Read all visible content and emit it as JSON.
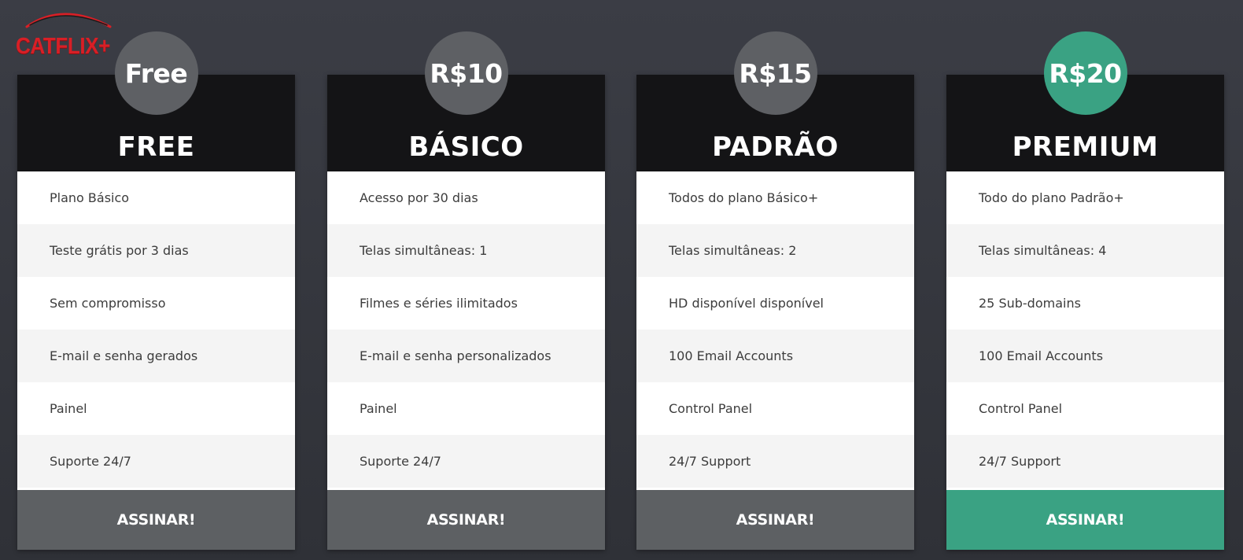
{
  "brand": {
    "logo_text": "CATFLIX+",
    "logo_color": "#d81f26"
  },
  "colors": {
    "background": "#35373d",
    "card_header": "#141416",
    "badge_default": "#5e6064",
    "accent": "#3aa283",
    "button_default": "#5d6063"
  },
  "plans": [
    {
      "price": "Free",
      "name": "FREE",
      "featured": false,
      "features": [
        "Plano Básico",
        "Teste grátis por 3 dias",
        "Sem compromisso",
        "E-mail e senha gerados",
        "Painel",
        "Suporte 24/7"
      ],
      "button_label": "ASSINAR!"
    },
    {
      "price": "R$10",
      "name": "BÁSICO",
      "featured": false,
      "features": [
        "Acesso por 30 dias",
        "Telas simultâneas: 1",
        "Filmes e séries ilimitados",
        "E-mail e senha personalizados",
        "Painel",
        "Suporte 24/7"
      ],
      "button_label": "ASSINAR!"
    },
    {
      "price": "R$15",
      "name": "PADRÃO",
      "featured": false,
      "features": [
        "Todos do plano Básico+",
        "Telas simultâneas: 2",
        "HD disponível disponível",
        "100 Email Accounts",
        "Control Panel",
        "24/7 Support"
      ],
      "button_label": "ASSINAR!"
    },
    {
      "price": "R$20",
      "name": "PREMIUM",
      "featured": true,
      "features": [
        "Todo do plano Padrão+",
        "Telas simultâneas: 4",
        "25 Sub-domains",
        "100 Email Accounts",
        "Control Panel",
        "24/7 Support"
      ],
      "button_label": "ASSINAR!"
    }
  ]
}
